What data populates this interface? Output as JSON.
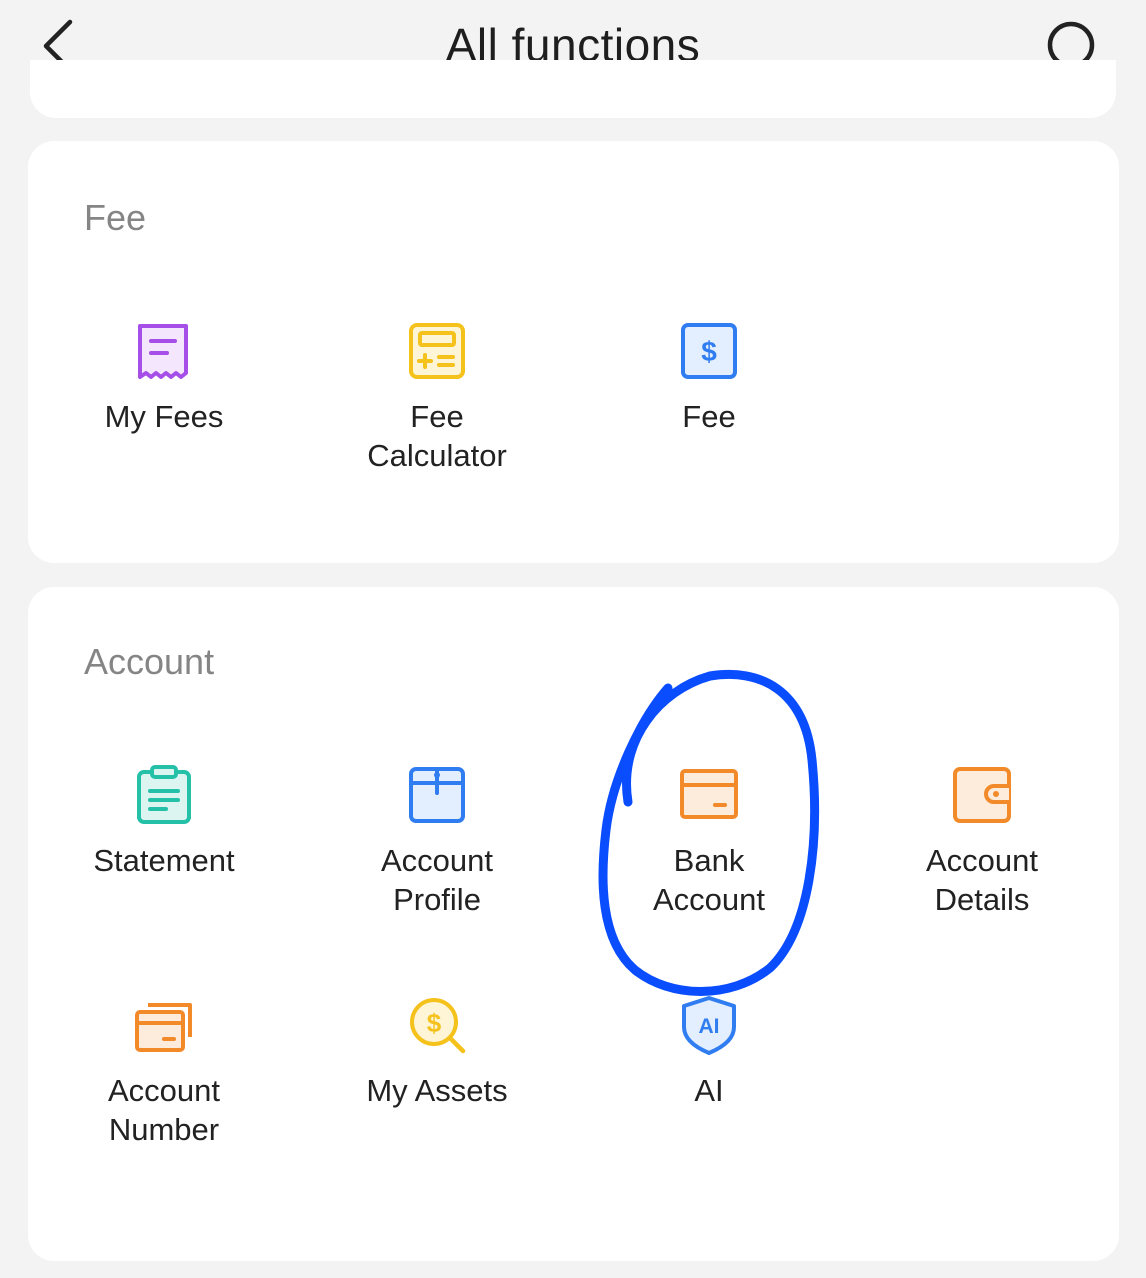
{
  "header": {
    "title": "All functions",
    "back_icon": "chevron-left-icon",
    "search_icon": "search-icon"
  },
  "sections": {
    "fee": {
      "title": "Fee",
      "items": [
        {
          "label": "My Fees",
          "icon": "receipt-icon",
          "color": "#a64ee8"
        },
        {
          "label": "Fee\nCalculator",
          "icon": "calculator-icon",
          "color": "#f5c11b"
        },
        {
          "label": "Fee",
          "icon": "dollar-document-icon",
          "color": "#2f7df0"
        }
      ]
    },
    "account": {
      "title": "Account",
      "items": [
        {
          "label": "Statement",
          "icon": "clipboard-icon",
          "color": "#25c0a8"
        },
        {
          "label": "Account\nProfile",
          "icon": "profile-folder-icon",
          "color": "#2f7df0"
        },
        {
          "label": "Bank\nAccount",
          "icon": "card-icon",
          "color": "#f28a2a"
        },
        {
          "label": "Account\nDetails",
          "icon": "wallet-icon",
          "color": "#f28a2a"
        },
        {
          "label": "Account\nNumber",
          "icon": "cards-stack-icon",
          "color": "#f28a2a"
        },
        {
          "label": "My Assets",
          "icon": "dollar-search-icon",
          "color": "#f5c11b"
        },
        {
          "label": "AI",
          "icon": "ai-shield-icon",
          "color": "#2f7df0",
          "icon_text": "AI"
        }
      ]
    }
  },
  "annotation": {
    "type": "hand-drawn-circle",
    "target": "Bank Account",
    "color": "#0a4dff"
  }
}
